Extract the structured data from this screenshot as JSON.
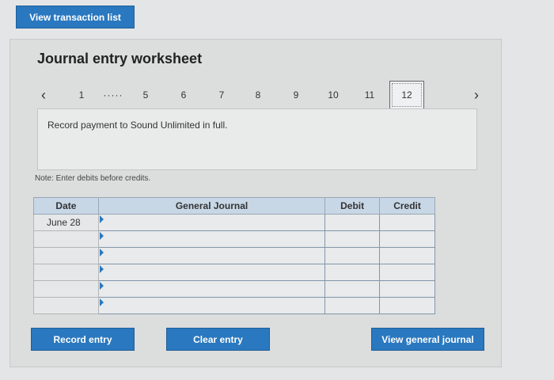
{
  "header": {
    "view_transactions_label": "View transaction list"
  },
  "worksheet": {
    "title": "Journal entry worksheet",
    "pager": {
      "prev_icon": "chevron-left-icon",
      "next_icon": "chevron-right-icon",
      "items": [
        "1",
        "·····",
        "5",
        "6",
        "7",
        "8",
        "9",
        "10",
        "11",
        "12"
      ],
      "selected": "12"
    },
    "instruction": "Record payment to Sound Unlimited in full.",
    "note": "Note: Enter debits before credits.",
    "table": {
      "headers": {
        "date": "Date",
        "journal": "General Journal",
        "debit": "Debit",
        "credit": "Credit"
      },
      "rows": [
        {
          "date": "June 28"
        },
        {
          "date": ""
        },
        {
          "date": ""
        },
        {
          "date": ""
        },
        {
          "date": ""
        },
        {
          "date": ""
        }
      ]
    }
  },
  "actions": {
    "record_entry": "Record entry",
    "clear_entry": "Clear entry",
    "view_general_journal": "View general journal"
  },
  "colors": {
    "accent": "#2a78bf",
    "header_row": "#c8d7e6"
  }
}
